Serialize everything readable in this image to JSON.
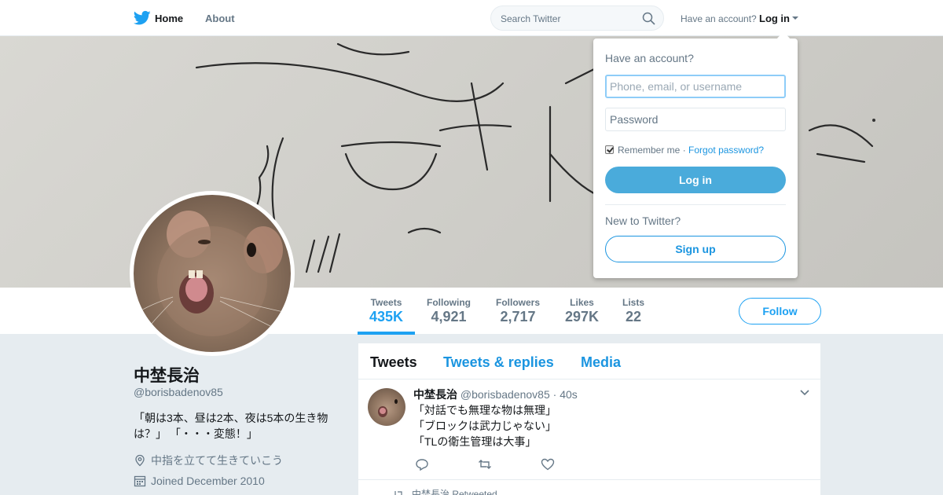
{
  "nav": {
    "home_label": "Home",
    "about_label": "About",
    "search_placeholder": "Search Twitter",
    "have_account": "Have an account?",
    "login_label": "Log in"
  },
  "profile": {
    "name": "中埜長治",
    "handle": "@borisbadenov85",
    "bio": "「朝は3本、昼は2本、夜は5本の生き物は？」 「・・・変態！」",
    "location": "中指を立てて生きていこう",
    "joined": "Joined December 2010"
  },
  "stats": [
    {
      "label": "Tweets",
      "value": "435K"
    },
    {
      "label": "Following",
      "value": "4,921"
    },
    {
      "label": "Followers",
      "value": "2,717"
    },
    {
      "label": "Likes",
      "value": "297K"
    },
    {
      "label": "Lists",
      "value": "22"
    }
  ],
  "follow_label": "Follow",
  "timeline": {
    "tabs": [
      "Tweets",
      "Tweets & replies",
      "Media"
    ],
    "tweet": {
      "name": "中埜長治",
      "handle": "@borisbadenov85",
      "time": "· 40s",
      "lines": [
        "「対話でも無理な物は無理」",
        "「ブロックは武力じゃない」",
        "「TLの衛生管理は大事」"
      ]
    },
    "retweet_label": "中埜長治 Retweeted"
  },
  "login_dropdown": {
    "title": "Have an account?",
    "username_placeholder": "Phone, email, or username",
    "password_placeholder": "Password",
    "remember_label": "Remember me",
    "separator": "·",
    "forgot_label": "Forgot password?",
    "login_button": "Log in",
    "new_label": "New to Twitter?",
    "signup_button": "Sign up"
  },
  "colors": {
    "accent": "#1da1f2",
    "login_button": "#4aabdb",
    "text_secondary": "#657786"
  },
  "icons": [
    "twitter-bird-icon",
    "search-icon",
    "caret-down-icon",
    "location-icon",
    "calendar-icon",
    "chevron-down-icon",
    "reply-icon",
    "retweet-icon",
    "like-icon"
  ]
}
